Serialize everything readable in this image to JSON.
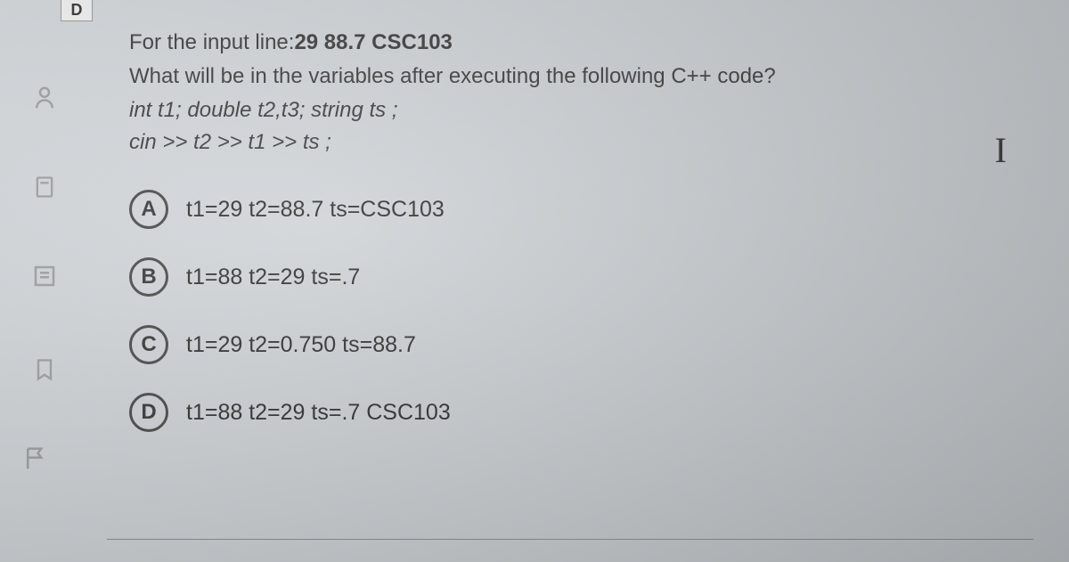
{
  "tab": {
    "label": "D"
  },
  "question": {
    "intro": "For the input line:",
    "input_data": "29 88.7 CSC103",
    "prompt": "What will be in the variables after executing the following C++ code?",
    "code_line1": "int t1; double t2,t3; string ts ;",
    "code_line2": "cin >> t2 >> t1 >> ts ;"
  },
  "options": [
    {
      "letter": "A",
      "text": "t1=29  t2=88.7  ts=CSC103"
    },
    {
      "letter": "B",
      "text": "t1=88  t2=29 ts=.7"
    },
    {
      "letter": "C",
      "text": "t1=29  t2=0.750 ts=88.7"
    },
    {
      "letter": "D",
      "text": "t1=88  t2=29 ts=.7 CSC103"
    }
  ],
  "cursor": "I"
}
